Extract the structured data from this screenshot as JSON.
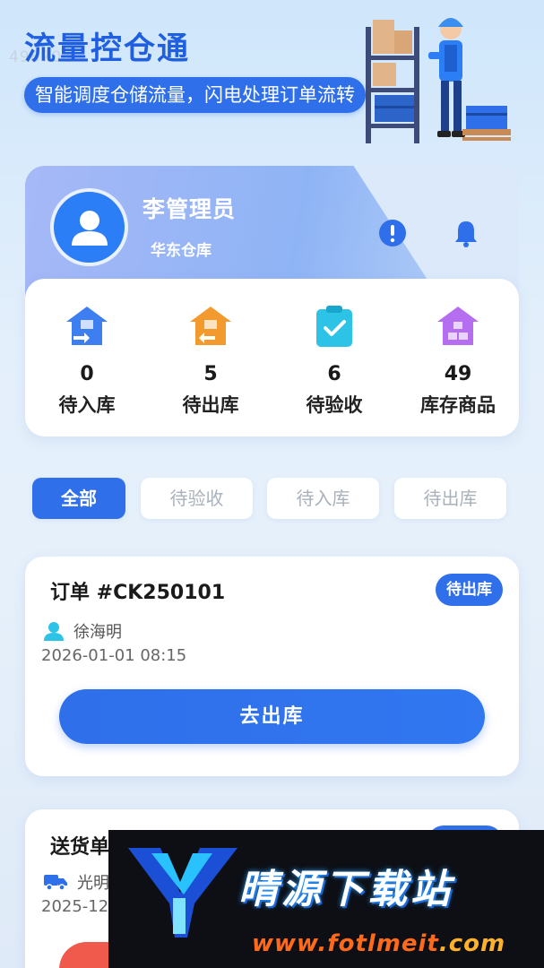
{
  "watermark_id": "49870a",
  "header": {
    "title": "流量控仓通",
    "slogan": "智能调度仓储流量，闪电处理订单流转"
  },
  "profile": {
    "name": "李管理员",
    "warehouse": "华东仓库"
  },
  "stats": [
    {
      "value": "0",
      "label": "待入库",
      "icon": "inbound-warehouse-icon",
      "color": "#3d7ef0"
    },
    {
      "value": "5",
      "label": "待出库",
      "icon": "outbound-warehouse-icon",
      "color": "#f39a2e"
    },
    {
      "value": "6",
      "label": "待验收",
      "icon": "clipboard-check-icon",
      "color": "#2cc3e6"
    },
    {
      "value": "49",
      "label": "库存商品",
      "icon": "inventory-house-icon",
      "color": "#b66ef0"
    }
  ],
  "tabs": [
    {
      "label": "全部",
      "active": true
    },
    {
      "label": "待验收",
      "active": false
    },
    {
      "label": "待入库",
      "active": false
    },
    {
      "label": "待出库",
      "active": false
    }
  ],
  "orders": [
    {
      "title": "订单 #CK250101",
      "status": "待出库",
      "person": "徐海明",
      "time": "2026-01-01 08:15",
      "action": "去出库"
    },
    {
      "title": "送货单",
      "source": "光明",
      "time": "2025-12"
    }
  ],
  "banner": {
    "site_name": "晴源下载站",
    "url_main": "www.fotlmeit",
    "url_tail": ".com"
  },
  "colors": {
    "primary": "#2f6fea",
    "danger": "#ef5a4d"
  }
}
